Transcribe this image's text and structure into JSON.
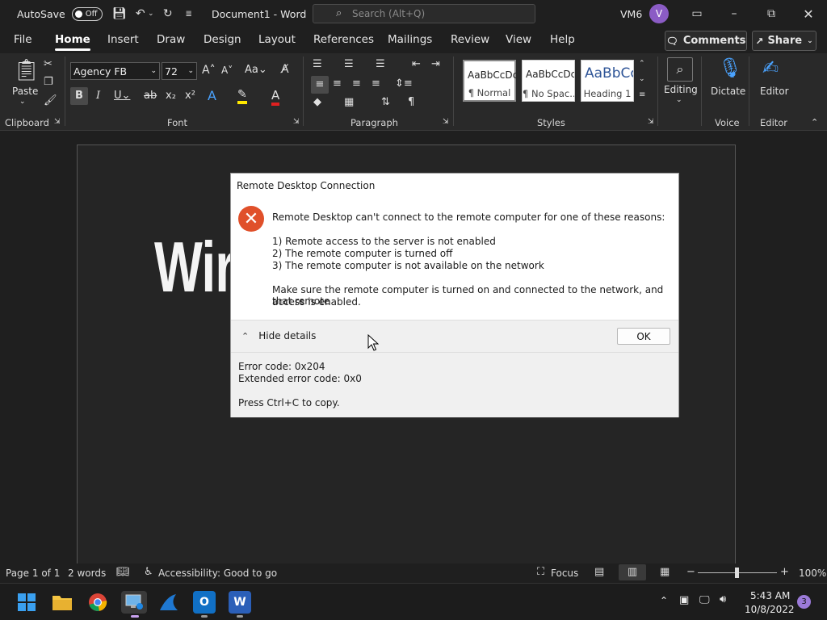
{
  "titlebar": {
    "autosave_label": "AutoSave",
    "autosave_state": "Off",
    "document_title": "Document1 - Word",
    "search_placeholder": "Search (Alt+Q)",
    "user_initials_label": "VM6",
    "avatar_letter": "V"
  },
  "menu": {
    "tabs": [
      "File",
      "Home",
      "Insert",
      "Draw",
      "Design",
      "Layout",
      "References",
      "Mailings",
      "Review",
      "View",
      "Help"
    ],
    "active_tab": "Home",
    "comments_label": "Comments",
    "share_label": "Share"
  },
  "ribbon": {
    "paste_label": "Paste",
    "font_name": "Agency FB",
    "font_size": "72",
    "styles": [
      {
        "sample": "AaBbCcDc",
        "name": "¶ Normal"
      },
      {
        "sample": "AaBbCcDc",
        "name": "¶ No Spac..."
      },
      {
        "sample": "AaBbCc",
        "name": "Heading 1"
      }
    ],
    "editing_label": "Editing",
    "dictate_label": "Dictate",
    "editor_label": "Editor",
    "groups": {
      "clipboard": "Clipboard",
      "font": "Font",
      "paragraph": "Paragraph",
      "styles": "Styles",
      "voice": "Voice",
      "editor": "Editor"
    }
  },
  "document": {
    "visible_text": "Wir"
  },
  "dialog": {
    "title": "Remote Desktop Connection",
    "message": "Remote Desktop can't connect to the remote computer for one of these reasons:",
    "reasons": [
      "1) Remote access to the server is not enabled",
      "2) The remote computer is turned off",
      "3) The remote computer is not available on the network"
    ],
    "advice_line1": "Make sure the remote computer is turned on and connected to the network, and that remote",
    "advice_line2": "access is enabled.",
    "hide_details_label": "Hide details",
    "ok_label": "OK",
    "error_code": "Error code: 0x204",
    "extended_error_code": "Extended error code: 0x0",
    "copy_hint": "Press Ctrl+C to copy."
  },
  "statusbar": {
    "page": "Page 1 of 1",
    "words": "2 words",
    "accessibility": "Accessibility: Good to go",
    "focus": "Focus",
    "zoom": "100%"
  },
  "taskbar": {
    "time": "5:43 AM",
    "date": "10/8/2022",
    "notification_count": "3"
  },
  "colors": {
    "accent_error": "#e0502a",
    "avatar": "#8b5cc5",
    "word_blue": "#2b5fb8",
    "outlook_blue": "#1170c5"
  }
}
